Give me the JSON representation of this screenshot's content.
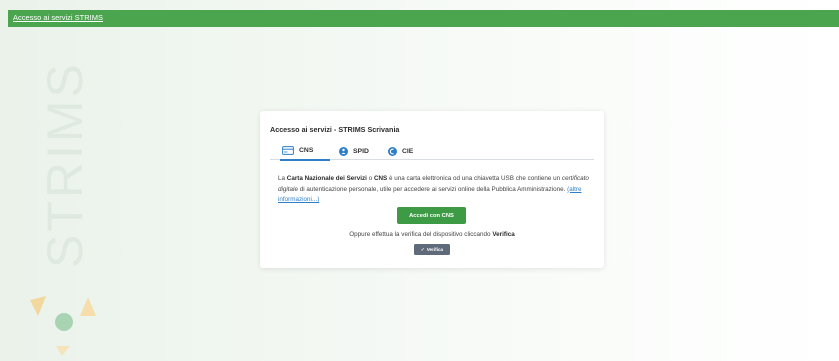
{
  "topbar": {
    "link_label": "Accesso ai servizi STRIMS"
  },
  "background": {
    "logo_text": "STRIMS",
    "accent": "#4ba54f"
  },
  "card": {
    "title": "Accesso ai servizi - STRIMS Scrivania",
    "tabs": [
      {
        "label": "CNS",
        "icon": "card-icon",
        "active": true
      },
      {
        "label": "SPID",
        "icon": "spid-icon",
        "active": false
      },
      {
        "label": "CIE",
        "icon": "cie-icon",
        "active": false
      }
    ],
    "description": {
      "p1": "La ",
      "b1": "Carta Nazionale dei Servizi",
      "p2": " o ",
      "b2": "CNS",
      "p3": " è una carta elettronica od una chiavetta USB che contiene un ",
      "i1": "certificato digitale",
      "p4": " di autenticazione personale, utile per accedere ai servizi online della Pubblica Amministrazione. ",
      "link": "(altre informazioni...)"
    },
    "access_button_label": "Accedi con CNS",
    "alt_text_prefix": "Oppure effettua la verifica del dispositivo cliccando ",
    "alt_text_bold": "Verifica",
    "verify_button_label": "Verifica"
  },
  "colors": {
    "primary_green": "#3d9a45",
    "link_blue": "#2f7fc8",
    "verify_gray": "#5f6b7a"
  }
}
